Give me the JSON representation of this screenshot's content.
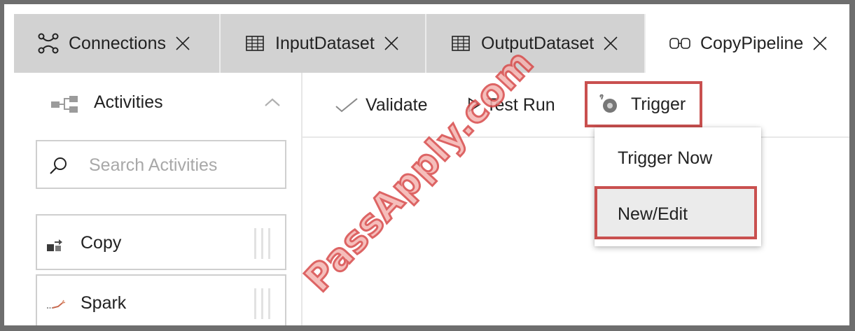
{
  "tabs": [
    {
      "label": "Connections",
      "icon": "connections-icon",
      "active": false
    },
    {
      "label": "InputDataset",
      "icon": "table-icon",
      "active": false
    },
    {
      "label": "OutputDataset",
      "icon": "table-icon",
      "active": false
    },
    {
      "label": "CopyPipeline",
      "icon": "pipeline-icon",
      "active": true
    }
  ],
  "sidebar": {
    "header_label": "Activities",
    "header_icon": "activities-icon",
    "search": {
      "placeholder": "Search Activities",
      "value": ""
    },
    "items": [
      {
        "label": "Copy",
        "icon": "copy-activity-icon"
      },
      {
        "label": "Spark",
        "icon": "spark-activity-icon"
      }
    ]
  },
  "toolbar": {
    "validate_label": "Validate",
    "test_run_label": "Test Run",
    "trigger_label": "Trigger"
  },
  "trigger_menu": {
    "items": [
      {
        "label": "Trigger Now",
        "selected": false
      },
      {
        "label": "New/Edit",
        "selected": true
      }
    ]
  },
  "watermark": "PassApply.com",
  "colors": {
    "highlight_border": "#c9504f",
    "tab_inactive_bg": "#d2d2d2",
    "selected_item_bg": "#ebebeb",
    "watermark_fill": "#f4b3b0"
  }
}
